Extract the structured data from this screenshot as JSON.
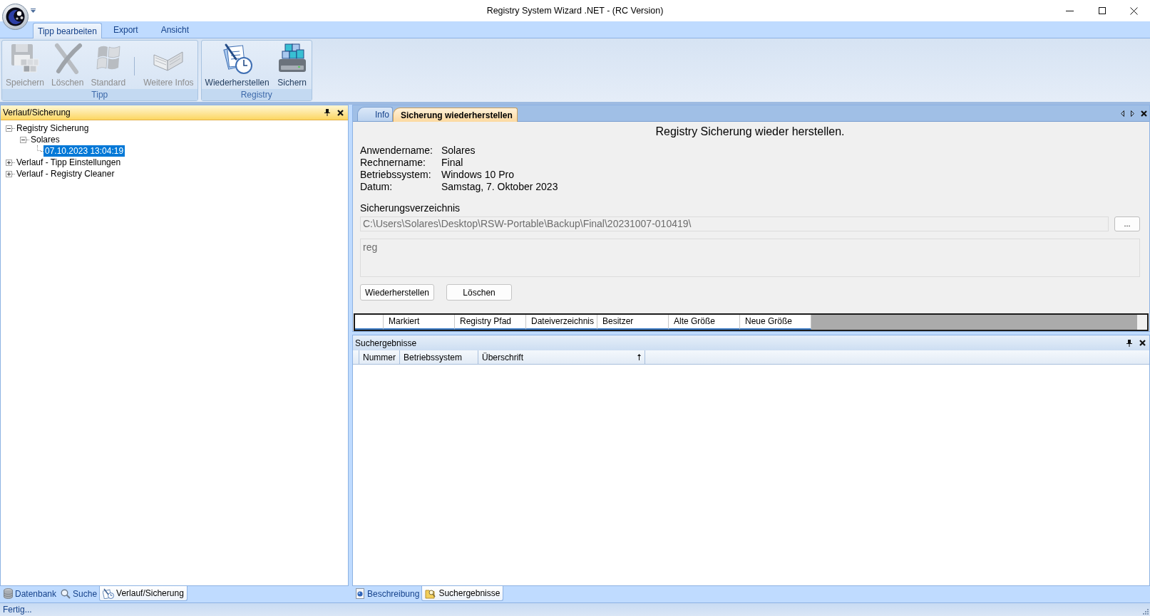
{
  "window": {
    "title": "Registry System Wizard .NET - (RC Version)"
  },
  "ribbon": {
    "tabs": [
      {
        "label": "Tipp bearbeiten",
        "selected": true
      },
      {
        "label": "Export",
        "selected": false
      },
      {
        "label": "Ansicht",
        "selected": false
      }
    ],
    "groups": [
      {
        "label": "Tipp",
        "buttons": [
          {
            "label": "Speichern",
            "disabled": true,
            "separator_before": false
          },
          {
            "label": "Löschen",
            "disabled": true,
            "separator_before": false
          },
          {
            "label": "Standard",
            "disabled": true,
            "separator_before": false
          },
          {
            "label": "Weitere Infos",
            "disabled": true,
            "separator_before": true
          }
        ]
      },
      {
        "label": "Registry",
        "buttons": [
          {
            "label": "Wiederherstellen",
            "disabled": false,
            "separator_before": false
          },
          {
            "label": "Sichern",
            "disabled": false,
            "separator_before": false
          }
        ]
      }
    ]
  },
  "history_panel": {
    "title": "Verlauf/Sicherung",
    "tree": [
      {
        "label": "Registry Sicherung",
        "expanded": true,
        "selected": false,
        "children": [
          {
            "label": "Solares",
            "expanded": true,
            "selected": false,
            "children": [
              {
                "label": "07.10.2023 13:04:19",
                "selected": true
              }
            ]
          }
        ]
      },
      {
        "label": "Verlauf - Tipp Einstellungen",
        "expanded": false,
        "selected": false
      },
      {
        "label": "Verlauf - Registry Cleaner",
        "expanded": false,
        "selected": false
      }
    ]
  },
  "backup_panel": {
    "tabs": [
      {
        "label": "Info",
        "selected": false
      },
      {
        "label": "Sicherung wiederherstellen",
        "selected": true
      }
    ],
    "heading": "Registry Sicherung wieder herstellen.",
    "details": [
      {
        "label": "Anwendername:",
        "value": "Solares"
      },
      {
        "label": "Rechnername:",
        "value": "Final"
      },
      {
        "label": "Betriebssystem:",
        "value": "Windows 10 Pro"
      },
      {
        "label": "Datum:",
        "value": "Samstag, 7. Oktober 2023"
      }
    ],
    "directory": {
      "label": "Sicherungsverzeichnis",
      "value": "C:\\Users\\Solares\\Desktop\\RSW-Portable\\Backup\\Final\\20231007-010419\\",
      "disabled": true,
      "browse_button": "..."
    },
    "notes": {
      "value": "reg",
      "disabled": true
    },
    "buttons": [
      {
        "label": "Wiederherstellen"
      },
      {
        "label": "Löschen"
      }
    ],
    "grid": {
      "columns": [
        "Markiert",
        "Registry Pfad",
        "Dateiverzeichnis",
        "Besitzer",
        "Alte Größe",
        "Neue Größe"
      ]
    }
  },
  "search_panel": {
    "title": "Suchergebnisse",
    "columns": [
      {
        "label": "Nummer",
        "sorted": false
      },
      {
        "label": "Betriebssystem",
        "sorted": false
      },
      {
        "label": "Überschrift",
        "sorted": true
      }
    ]
  },
  "left_dock_tabs": [
    {
      "label": "Datenbank",
      "selected": false
    },
    {
      "label": "Suche",
      "selected": false
    },
    {
      "label": "Verlauf/Sicherung",
      "selected": true
    }
  ],
  "right_dock_tabs": [
    {
      "label": "Beschreibung",
      "selected": false
    },
    {
      "label": "Suchergebnisse",
      "selected": true
    }
  ],
  "status_bar": {
    "text": "Fertig..."
  }
}
